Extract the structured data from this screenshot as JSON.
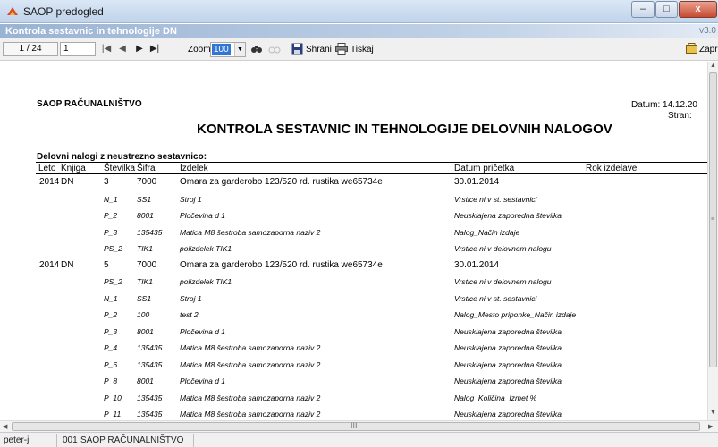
{
  "window": {
    "title": "SAOP predogled",
    "subtitle": "Kontrola sestavnic in tehnologije DN",
    "version": "v3.0",
    "controls": [
      "–",
      "□",
      "x"
    ]
  },
  "toolbar": {
    "page_count": "1 / 24",
    "page_input": "1",
    "nav_icons": [
      "first-page-icon",
      "prev-page-icon",
      "next-page-icon",
      "last-page-icon"
    ],
    "zoom_label": "Zoom:",
    "zoom_value": "100",
    "save_label": "Shrani",
    "print_label": "Tiskaj",
    "close_label": "Zapri"
  },
  "report": {
    "company": "SAOP RAČUNALNIŠTVO",
    "datum": "Datum:  14.12.20",
    "stran": "Stran:",
    "title": "KONTROLA SESTAVNIC IN TEHNOLOGIJE DELOVNIH NALOGOV",
    "section": "Delovni nalogi z neustrezno sestavnico:",
    "headers": {
      "leto": "Leto",
      "knjiga": "Knjiga",
      "stevilka": "Številka",
      "sifra": "Šifra",
      "izdelek": "Izdelek",
      "datum_pricetka": "Datum pričetka",
      "rok_izdelave": "Rok izdelave"
    },
    "rows": [
      {
        "type": "main",
        "leto": "2014",
        "knjiga": "DN",
        "stevilka": "3",
        "sifra": "7000",
        "izdelek": "Omara za garderobo 123/520 rd. rustika  we65734e",
        "datum": "30.01.2014"
      },
      {
        "type": "sub",
        "stevilka": "N_1",
        "sifra": "SS1",
        "izdelek": "Stroj 1",
        "datum": "Vrstice ni v st. sestavnici"
      },
      {
        "type": "sub",
        "stevilka": "P_2",
        "sifra": "8001",
        "izdelek": "Pločevina d 1",
        "datum": "Neusklajena zaporedna številka"
      },
      {
        "type": "sub",
        "stevilka": "P_3",
        "sifra": "135435",
        "izdelek": "Matica M8 šestroba samozaporna naziv 2",
        "datum": "Nalog_Način izdaje"
      },
      {
        "type": "sub",
        "stevilka": "PS_2",
        "sifra": "TIK1",
        "izdelek": "polizdelek TIK1",
        "datum": "Vrstice ni v delovnem nalogu"
      },
      {
        "type": "main",
        "leto": "2014",
        "knjiga": "DN",
        "stevilka": "5",
        "sifra": "7000",
        "izdelek": "Omara za garderobo 123/520 rd. rustika  we65734e",
        "datum": "30.01.2014"
      },
      {
        "type": "sub",
        "stevilka": "PS_2",
        "sifra": "TIK1",
        "izdelek": "polizdelek TIK1",
        "datum": "Vrstice ni v delovnem nalogu"
      },
      {
        "type": "sub",
        "stevilka": "N_1",
        "sifra": "SS1",
        "izdelek": "Stroj 1",
        "datum": "Vrstice ni v st. sestavnici"
      },
      {
        "type": "sub",
        "stevilka": "P_2",
        "sifra": "100",
        "izdelek": "test 2",
        "datum": "Nalog_Mesto priponke_Način izdaje"
      },
      {
        "type": "sub",
        "stevilka": "P_3",
        "sifra": "8001",
        "izdelek": "Pločevina d 1",
        "datum": "Neusklajena zaporedna številka"
      },
      {
        "type": "sub",
        "stevilka": "P_4",
        "sifra": "135435",
        "izdelek": "Matica M8 šestroba samozaporna naziv 2",
        "datum": "Neusklajena zaporedna številka"
      },
      {
        "type": "sub",
        "stevilka": "P_6",
        "sifra": "135435",
        "izdelek": "Matica M8 šestroba samozaporna naziv 2",
        "datum": "Neusklajena zaporedna številka"
      },
      {
        "type": "sub",
        "stevilka": "P_8",
        "sifra": "8001",
        "izdelek": "Pločevina d 1",
        "datum": "Neusklajena zaporedna številka"
      },
      {
        "type": "sub",
        "stevilka": "P_10",
        "sifra": "135435",
        "izdelek": "Matica M8 šestroba samozaporna naziv 2",
        "datum": "Nalog_Količina_Izmet %"
      },
      {
        "type": "sub",
        "stevilka": "P_11",
        "sifra": "135435",
        "izdelek": "Matica M8 šestroba samozaporna naziv 2",
        "datum": "Neusklajena zaporedna številka"
      }
    ]
  },
  "status": {
    "user": "peter-j",
    "company_code": "001",
    "company_name": "SAOP RAČUNALNIŠTVO"
  },
  "colors": {
    "accent": "#3176d6",
    "close": "#c64a32"
  }
}
